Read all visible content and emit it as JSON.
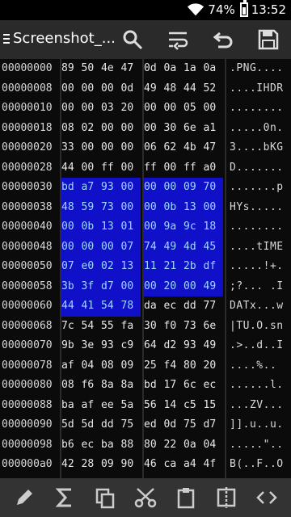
{
  "status_bar": {
    "battery": "74%",
    "time": "13:52"
  },
  "toolbar": {
    "title": "Screenshot_..."
  },
  "rows": [
    {
      "addr": "00000000",
      "bytes": [
        "89",
        "50",
        "4e",
        "47",
        "0d",
        "0a",
        "1a",
        "0a"
      ],
      "ascii": ".PNG....",
      "sel": []
    },
    {
      "addr": "00000008",
      "bytes": [
        "00",
        "00",
        "00",
        "0d",
        "49",
        "48",
        "44",
        "52"
      ],
      "ascii": "....IHDR",
      "sel": []
    },
    {
      "addr": "00000010",
      "bytes": [
        "00",
        "00",
        "03",
        "20",
        "00",
        "00",
        "05",
        "00"
      ],
      "ascii": "........",
      "sel": []
    },
    {
      "addr": "00000018",
      "bytes": [
        "08",
        "02",
        "00",
        "00",
        "00",
        "30",
        "6e",
        "a1"
      ],
      "ascii": ".....0n.",
      "sel": []
    },
    {
      "addr": "00000020",
      "bytes": [
        "33",
        "00",
        "00",
        "00",
        "06",
        "62",
        "4b",
        "47"
      ],
      "ascii": "3....bKG",
      "sel": []
    },
    {
      "addr": "00000028",
      "bytes": [
        "44",
        "00",
        "ff",
        "00",
        "ff",
        "00",
        "ff",
        "a0"
      ],
      "ascii": "D.......",
      "sel": []
    },
    {
      "addr": "00000030",
      "bytes": [
        "bd",
        "a7",
        "93",
        "00",
        "00",
        "00",
        "09",
        "70"
      ],
      "ascii": ".......p",
      "sel": [
        0,
        1,
        2,
        3,
        4,
        5,
        6,
        7
      ]
    },
    {
      "addr": "00000038",
      "bytes": [
        "48",
        "59",
        "73",
        "00",
        "00",
        "0b",
        "13",
        "00"
      ],
      "ascii": "HYs.....",
      "sel": [
        0,
        1,
        2,
        3,
        4,
        5,
        6,
        7
      ]
    },
    {
      "addr": "00000040",
      "bytes": [
        "00",
        "0b",
        "13",
        "01",
        "00",
        "9a",
        "9c",
        "18"
      ],
      "ascii": "........",
      "sel": [
        0,
        1,
        2,
        3,
        4,
        5,
        6,
        7
      ]
    },
    {
      "addr": "00000048",
      "bytes": [
        "00",
        "00",
        "00",
        "07",
        "74",
        "49",
        "4d",
        "45"
      ],
      "ascii": "....tIME",
      "sel": [
        0,
        1,
        2,
        3,
        4,
        5,
        6,
        7
      ]
    },
    {
      "addr": "00000050",
      "bytes": [
        "07",
        "e0",
        "02",
        "13",
        "11",
        "21",
        "2b",
        "df"
      ],
      "ascii": ".....!+.",
      "sel": [
        0,
        1,
        2,
        3,
        4,
        5,
        6,
        7
      ]
    },
    {
      "addr": "00000058",
      "bytes": [
        "3b",
        "3f",
        "d7",
        "00",
        "00",
        "20",
        "00",
        "49"
      ],
      "ascii": ";?... .I",
      "sel": [
        0,
        1,
        2,
        3,
        4,
        5,
        6,
        7
      ]
    },
    {
      "addr": "00000060",
      "bytes": [
        "44",
        "41",
        "54",
        "78",
        "da",
        "ec",
        "dd",
        "77"
      ],
      "ascii": "DATx...w",
      "sel": [
        0,
        1,
        2,
        3
      ]
    },
    {
      "addr": "00000068",
      "bytes": [
        "7c",
        "54",
        "55",
        "fa",
        "30",
        "f0",
        "73",
        "6e"
      ],
      "ascii": "|TU.O.sn",
      "sel": []
    },
    {
      "addr": "00000070",
      "bytes": [
        "9b",
        "3e",
        "93",
        "c9",
        "64",
        "d2",
        "93",
        "49"
      ],
      "ascii": ".>..d..I",
      "sel": []
    },
    {
      "addr": "00000078",
      "bytes": [
        "af",
        "04",
        "08",
        "09",
        "25",
        "f4",
        "80",
        "20"
      ],
      "ascii": "....%..",
      "sel": []
    },
    {
      "addr": "00000080",
      "bytes": [
        "08",
        "f6",
        "8a",
        "8a",
        "bd",
        "17",
        "6c",
        "ec"
      ],
      "ascii": "......l.",
      "sel": []
    },
    {
      "addr": "00000088",
      "bytes": [
        "ba",
        "af",
        "ee",
        "5a",
        "56",
        "14",
        "c5",
        "15"
      ],
      "ascii": "...ZV...",
      "sel": []
    },
    {
      "addr": "00000090",
      "bytes": [
        "5d",
        "5d",
        "dd",
        "75",
        "ed",
        "0d",
        "75",
        "d7"
      ],
      "ascii": "]].u..u.",
      "sel": []
    },
    {
      "addr": "00000098",
      "bytes": [
        "b6",
        "ec",
        "ba",
        "88",
        "80",
        "22",
        "0a",
        "04"
      ],
      "ascii": ".....\"..",
      "sel": []
    },
    {
      "addr": "000000a0",
      "bytes": [
        "42",
        "28",
        "09",
        "90",
        "46",
        "ca",
        "a4",
        "4f"
      ],
      "ascii": "B(..F..O",
      "sel": []
    }
  ],
  "bottom_icons": [
    "pencil-icon",
    "sigma-icon",
    "copy-icon",
    "cut-icon",
    "clipboard-icon",
    "split-icon",
    "code-icon"
  ]
}
